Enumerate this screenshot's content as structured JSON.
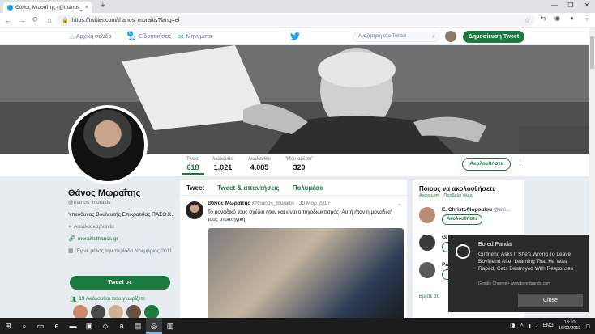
{
  "browser": {
    "tab_title": "Θάνος Μωραΐτης (@thanos_moraitis)",
    "tab_close": "×",
    "new_tab": "+",
    "url": "https://twitter.com/thanos_moraitis?lang=el",
    "window_controls": [
      "—",
      "❐",
      "✕"
    ]
  },
  "header": {
    "home_label": "Αρχική σελίδα",
    "notifications_label": "Ειδοποιήσεις",
    "notifications_count": "6",
    "messages_label": "Μηνύματα",
    "search_placeholder": "Αναζήτηση στο Twitter",
    "tweet_button": "Δημοσίευση Tweet"
  },
  "profile_nav": {
    "stats": [
      {
        "label": "Tweet",
        "value": "618"
      },
      {
        "label": "Ακολουθεί",
        "value": "1.021"
      },
      {
        "label": "Ακόλουθοι",
        "value": "4.085"
      },
      {
        "label": "\"Μου αρέσει\"",
        "value": "320"
      }
    ],
    "follow_button": "Ακολουθήστε"
  },
  "profile": {
    "name": "Θάνος Μωραΐτης",
    "handle": "@thanos_moraitis",
    "bio": "Υπεύθυνος Βουλευτής Επικρατείας ΠΑΣΟ.Κ.",
    "location": "Αιτωλοακαρνανία",
    "website": "moraitisthanos.gr",
    "joined": "Έγινε μέλος την περίοδο Νοέμβριος 2011",
    "tweet_to_button": "Tweet σε",
    "followers_you_know": "19 Ακόλουθοι που γνωρίζετε"
  },
  "timeline": {
    "tabs": [
      "Tweet",
      "Tweet & απαντήσεις",
      "Πολυμέσα"
    ],
    "tweet": {
      "author": "Θάνος Μωραΐτης",
      "handle": "@thanos_moraitis",
      "date": "· 30 Μαρ 2017",
      "text": "Το μοναδικό τους σχέδιο ήταν και είναι ο τυχοδιωκτισμός. Αυτή ήταν η μοναδική τους στρατηγική"
    }
  },
  "who_to_follow": {
    "title": "Ποιους να ακολουθήσετε",
    "refresh": "Ανανέωση",
    "view_all": "Προβολή όλων",
    "items": [
      {
        "name": "E. Christofilopoulou",
        "handle": "@evi...",
        "button": "Ακολουθήστε"
      },
      {
        "name": "Gi",
        "handle": "",
        "button": "Ακ"
      },
      {
        "name": "Pa",
        "handle": "",
        "button": "Ακ"
      }
    ],
    "find_people": "Βρείτε άτ"
  },
  "notification": {
    "app": "Bored Panda",
    "message": "Girlfriend Asks If She's Wrong To Leave Boyfriend After Learning That He Was Raped, Gets Destroyed With Responses",
    "source": "Google Chrome • www.boredpanda.com",
    "close_button": "Close"
  },
  "taskbar": {
    "language": "ENG",
    "time": "18:10",
    "date": "16/02/2019"
  },
  "colors": {
    "accent": "#1b7a3f",
    "twitter_blue": "#1da1f2"
  }
}
